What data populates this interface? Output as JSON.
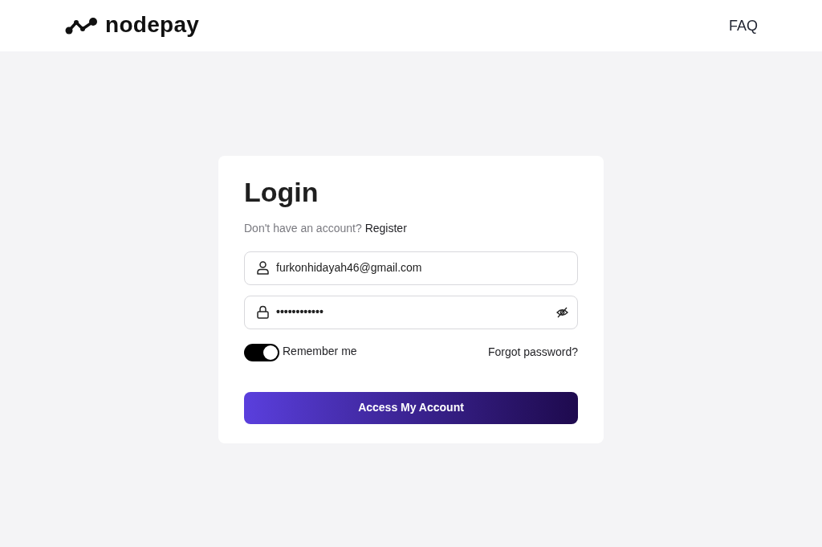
{
  "header": {
    "logo_text": "nodepay",
    "nav_link": "FAQ"
  },
  "login_card": {
    "title": "Login",
    "prompt": "Don't have an account?",
    "register_link": "Register",
    "email_field": {
      "value": "furkonhidayah46@gmail.com"
    },
    "password_field": {
      "value": "••••••••••••",
      "visible": false
    },
    "remember_me": {
      "label": "Remember me",
      "on": true
    },
    "forgot_link": "Forgot password?",
    "submit_button": "Access My Account"
  }
}
